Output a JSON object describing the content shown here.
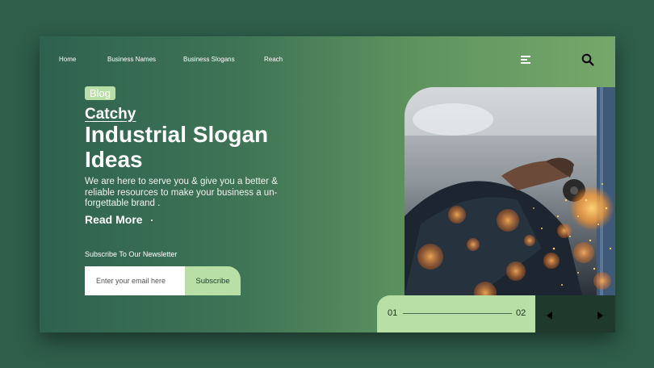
{
  "nav": {
    "items": [
      {
        "label": "Home"
      },
      {
        "label": "Business Names"
      },
      {
        "label": "Business Slogans"
      },
      {
        "label": "Reach"
      }
    ]
  },
  "hero": {
    "badge": "Blog",
    "kicker": "Catchy",
    "title": "Industrial Slogan Ideas",
    "description": "We are here to serve you & give you a better & reliable resources to make your business a un-forgettable brand .",
    "cta": "Read More"
  },
  "newsletter": {
    "label": "Subscribe To Our Newsletter",
    "placeholder": "Enter your email here",
    "button": "Subscribe"
  },
  "slider": {
    "start": "01",
    "end": "02"
  },
  "icons": {
    "menu": "hamburger-menu-icon",
    "search": "search-icon",
    "prev": "arrow-left-icon",
    "next": "arrow-right-icon"
  },
  "colors": {
    "accent_light": "#b8dfa6",
    "highlight": "#f0c419",
    "dark_panel": "#1f3a2c",
    "background": "#2f5e4b"
  }
}
